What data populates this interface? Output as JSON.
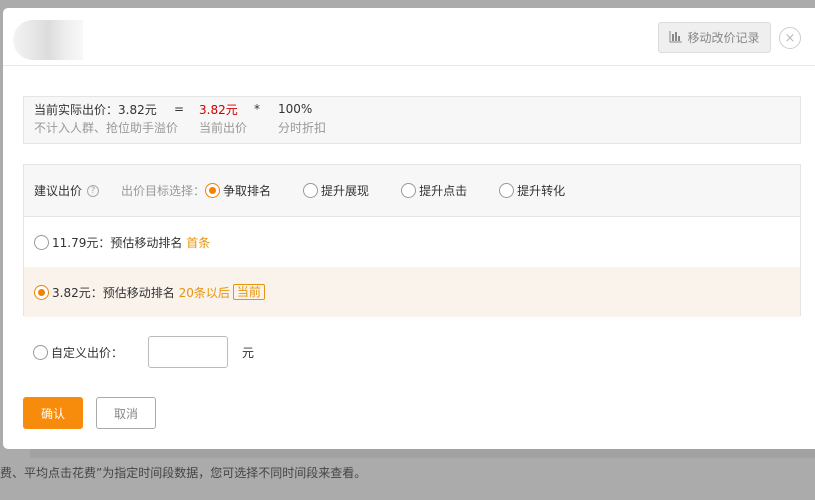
{
  "header": {
    "history_button": "移动改价记录",
    "close": "×"
  },
  "price": {
    "label": "当前实际出价：3.82元",
    "eq": "=",
    "bid": "3.82元",
    "times": "*",
    "discount": "100%",
    "sub_label": "不计入人群、抢位助手溢价",
    "sub_bid": "当前出价",
    "sub_discount": "分时折扣"
  },
  "suggest": {
    "title": "建议出价",
    "help": "?",
    "goal_label": "出价目标选择：",
    "goals": [
      {
        "label": "争取排名",
        "selected": true
      },
      {
        "label": "提升展现",
        "selected": false
      },
      {
        "label": "提升点击",
        "selected": false
      },
      {
        "label": "提升转化",
        "selected": false
      }
    ],
    "rows": [
      {
        "price": "11.79元：",
        "desc": "预估移动排名",
        "rank": "首条",
        "tag": "",
        "selected": false
      },
      {
        "price": "3.82元：",
        "desc": "预估移动排名",
        "rank": "20条以后",
        "tag": "当前",
        "selected": true
      }
    ]
  },
  "custom": {
    "label": "自定义出价：",
    "value": "",
    "unit": "元"
  },
  "buttons": {
    "ok": "确认",
    "cancel": "取消"
  },
  "background_note": "费、平均点击花费”为指定时间段数据，您可选择不同时间段来查看。"
}
